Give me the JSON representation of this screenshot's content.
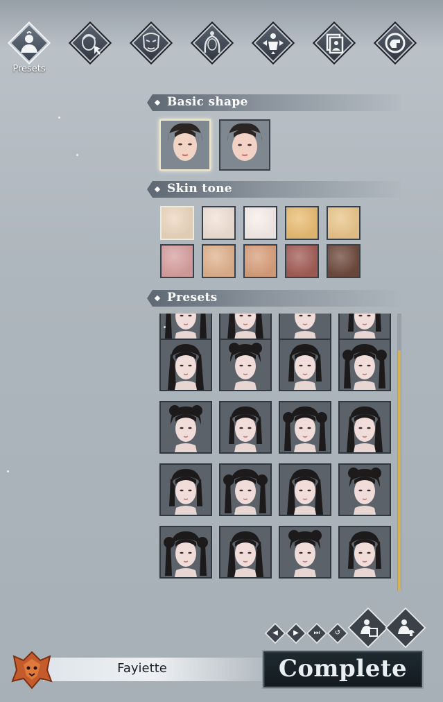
{
  "tabs": [
    {
      "name": "presets",
      "label": "Presets",
      "icon": "person-bust-icon",
      "active": true
    },
    {
      "name": "face",
      "label": "",
      "icon": "face-pointer-icon",
      "active": false
    },
    {
      "name": "makeup",
      "label": "",
      "icon": "mask-face-icon",
      "active": false
    },
    {
      "name": "hair",
      "label": "",
      "icon": "hairstyle-icon",
      "active": false
    },
    {
      "name": "body",
      "label": "",
      "icon": "body-arrows-icon",
      "active": false
    },
    {
      "name": "outfit",
      "label": "",
      "icon": "portrait-card-icon",
      "active": false
    },
    {
      "name": "pose",
      "label": "",
      "icon": "hand-gesture-icon",
      "active": false
    }
  ],
  "sections": {
    "basic_shape": "Basic shape",
    "skin_tone": "Skin tone",
    "presets": "Presets"
  },
  "skin_tones": [
    "#ecd6be",
    "#f1e1d6",
    "#f7eeea",
    "#e9bd72",
    "#eac58a",
    "#d8a0a0",
    "#e0b28e",
    "#d9a07c",
    "#a35d56",
    "#6e4a3c"
  ],
  "selected_skin_tone": 0,
  "basic_shape_selected": 0,
  "accent": "#d6b253",
  "character": {
    "name": "Fayiette"
  },
  "footer": {
    "complete_label": "Complete",
    "small_buttons": [
      "diamond-left-icon",
      "diamond-right-icon",
      "skip-icon",
      "undo-icon"
    ],
    "big_buttons": [
      "save-preset-icon",
      "load-preset-icon"
    ]
  }
}
